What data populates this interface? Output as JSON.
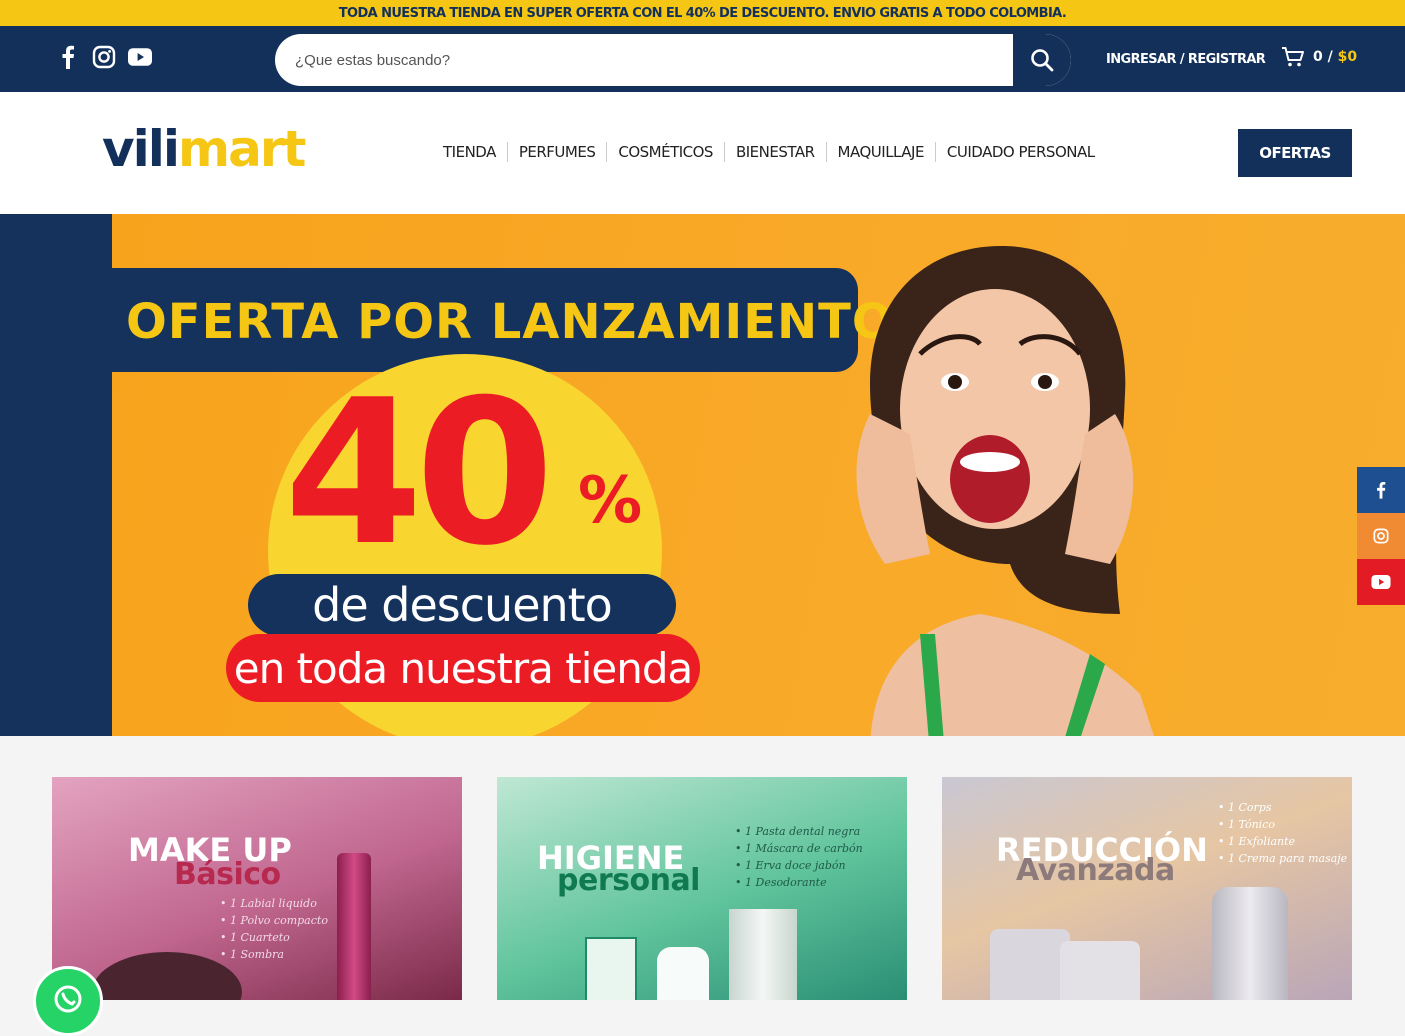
{
  "promo_bar": {
    "text": "TODA NUESTRA TIENDA EN SUPER OFERTA CON EL 40% DE DESCUENTO. ENVIO GRATIS A TODO COLOMBIA."
  },
  "topbar": {
    "social": [
      "facebook-icon",
      "instagram-icon",
      "youtube-icon"
    ],
    "search": {
      "placeholder": "¿Que estas buscando?",
      "value": ""
    },
    "account_label": "INGRESAR / REGISTRAR",
    "cart": {
      "count": "0",
      "separator": "/",
      "amount": "$0"
    }
  },
  "header": {
    "logo_part1": "vili",
    "logo_part2": "mart",
    "nav": [
      "TIENDA",
      "PERFUMES",
      "COSMÉTICOS",
      "BIENESTAR",
      "MAQUILLAJE",
      "CUIDADO PERSONAL"
    ],
    "ofertas_label": "OFERTAS"
  },
  "hero": {
    "headline": "OFERTA POR LANZAMIENTO",
    "number": "40",
    "percent": "%",
    "line1": "de descuento",
    "line2": "en toda  nuestra tienda"
  },
  "side_social": [
    "facebook-icon",
    "instagram-icon",
    "youtube-icon"
  ],
  "cards": [
    {
      "title1": "MAKE UP",
      "title2": "Básico",
      "items": [
        "1 Labial liquido",
        "1 Polvo compacto",
        "1 Cuarteto",
        "1 Sombra"
      ]
    },
    {
      "title1": "HIGIENE",
      "title2": "personal",
      "items": [
        "1 Pasta dental negra",
        "1 Máscara de carbón",
        "1 Erva doce jabón",
        "1 Desodorante"
      ]
    },
    {
      "title1": "REDUCCIÓN",
      "title2": "Avanzada",
      "items": [
        "1 Corps",
        "1 Tónico",
        "1 Exfoliante",
        "1 Crema para masaje"
      ]
    }
  ],
  "colors": {
    "navy": "#12305a",
    "yellow": "#f6c615",
    "red": "#ec1c24",
    "orange": "#f7a21a",
    "facebook": "#1d4f91",
    "instagram": "#f08a33",
    "youtube": "#e21b24",
    "whatsapp": "#25d366"
  }
}
